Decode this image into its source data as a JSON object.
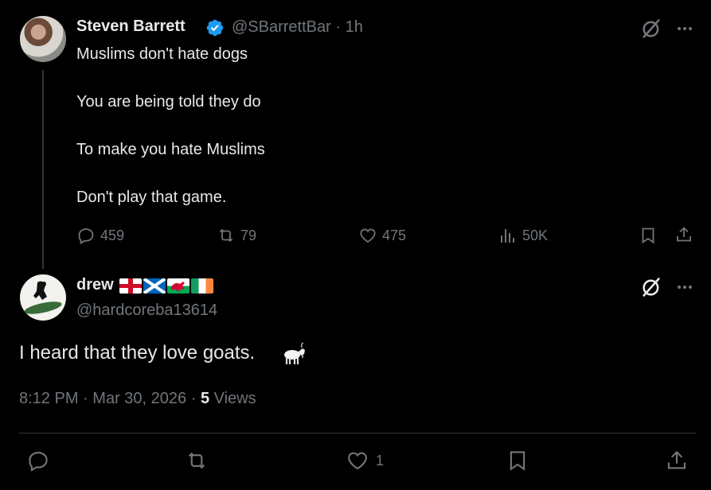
{
  "parent_tweet": {
    "display_name": "Steven Barrett",
    "handle": "@SBarrettBar",
    "separator": "·",
    "time_ago": "1h",
    "lines": [
      "Muslims don't hate dogs",
      "You are being told they do",
      "To make you hate Muslims",
      "Don't play that game."
    ],
    "stats": {
      "replies": "459",
      "reposts": "79",
      "likes": "475",
      "views": "50K"
    }
  },
  "reply_tweet": {
    "display_name": "drew",
    "flags": [
      "england-flag",
      "scotland-flag",
      "wales-flag",
      "ireland-flag"
    ],
    "handle": "@hardcoreba13614",
    "text": "I heard that they love goats.",
    "emoji": "goat-emoji",
    "time": "8:12 PM",
    "separator": "·",
    "date": "Mar 30, 2026",
    "separator2": "·",
    "views_count": "5",
    "views_label": "Views",
    "stats": {
      "likes": "1"
    }
  },
  "colors": {
    "background": "#000000",
    "text": "#e7e9ea",
    "muted": "#71767b",
    "verified": "#1d9bf0",
    "divider": "#2f3336"
  }
}
